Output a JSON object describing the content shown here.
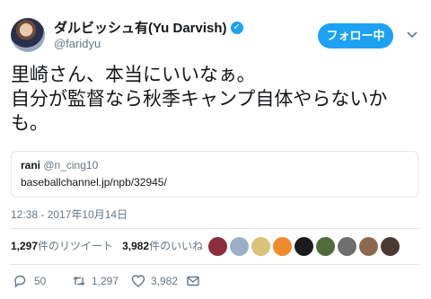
{
  "user": {
    "display_name": "ダルビッシュ有(Yu Darvish)",
    "handle": "@faridyu",
    "verified_glyph": "✓"
  },
  "follow_button": {
    "label": "フォロー中"
  },
  "tweet": {
    "line1": "里崎さん、本当にいいなぁ。",
    "line2": "自分が監督なら秋季キャンプ自体やらないか",
    "line3": "も。"
  },
  "quoted": {
    "name": "rani",
    "handle": "@n_cing10",
    "link": "baseballchannel.jp/npb/32945/"
  },
  "timestamp": "12:38 - 2017年10月14日",
  "stats": {
    "retweet_count": "1,297",
    "retweet_label": "件のリツイート",
    "like_count": "3,982",
    "like_label": "件のいいね"
  },
  "likers": [
    {
      "icon": "avatar-red-figure",
      "color": "#8b2e3b"
    },
    {
      "icon": "avatar-cartoon",
      "color": "#9bb0c7"
    },
    {
      "icon": "avatar-illustration",
      "color": "#d9c27a"
    },
    {
      "icon": "avatar-orange-badge",
      "color": "#f08a2c"
    },
    {
      "icon": "avatar-dark",
      "color": "#1b1b1b"
    },
    {
      "icon": "avatar-green",
      "color": "#4f6b3a"
    },
    {
      "icon": "avatar-grey",
      "color": "#6e6e6e"
    },
    {
      "icon": "avatar-brown",
      "color": "#8d6a4f"
    },
    {
      "icon": "avatar-person",
      "color": "#4a3b33"
    }
  ],
  "actions": {
    "reply_count": "50",
    "retweet_count": "1,297",
    "like_count": "3,982"
  },
  "colors": {
    "accent": "#1da1f2",
    "muted": "#657786",
    "border": "#e1e8ed"
  }
}
